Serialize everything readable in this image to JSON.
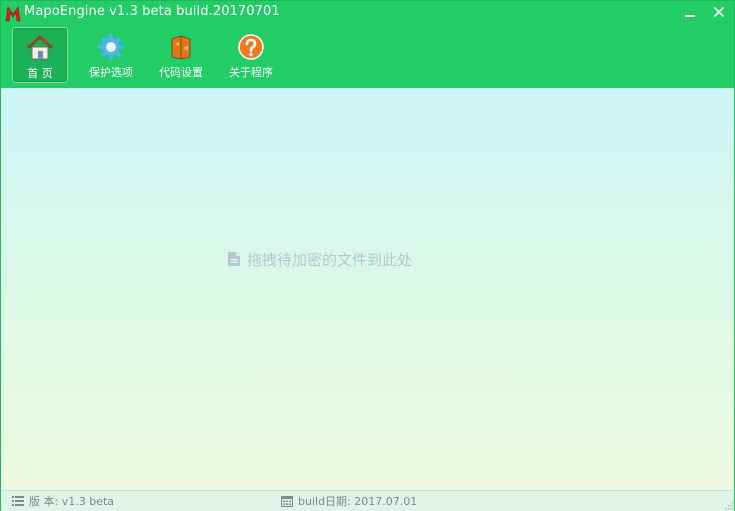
{
  "window": {
    "title": "MapoEngine v1.3 beta build.20170701"
  },
  "toolbar": {
    "items": [
      {
        "label": "首 页",
        "icon": "home-icon",
        "active": true
      },
      {
        "label": "保护选项",
        "icon": "gear-icon",
        "active": false
      },
      {
        "label": "代码设置",
        "icon": "puzzle-icon",
        "active": false
      },
      {
        "label": "关于程序",
        "icon": "help-icon",
        "active": false
      }
    ]
  },
  "main": {
    "drop_hint": "拖拽待加密的文件到此处",
    "drop_icon": "file-icon"
  },
  "status": {
    "version": "版 本: v1.3 beta",
    "build_date": "build日期: 2017.07.01"
  },
  "colors": {
    "header": "#22cc66",
    "content_top": "#ccf5f5",
    "content_bottom": "#eefbe0",
    "hint_text": "#b4c7cf",
    "status_bg": "#dff3e8"
  }
}
